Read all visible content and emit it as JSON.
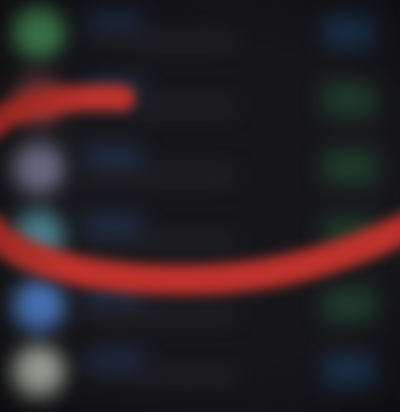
{
  "list": {
    "rows": [
      {
        "avatar_color": "#4c9a62",
        "action_color": "#1d3350",
        "avatar_icon": "app-icon"
      },
      {
        "avatar_color": "#7a3b3f",
        "action_color": "#1f3a2a",
        "avatar_icon": "app-icon"
      },
      {
        "avatar_color": "#6c6b82",
        "action_color": "#1f3a2a",
        "avatar_icon": "app-icon"
      },
      {
        "avatar_color": "#4b7f8c",
        "action_color": "#1f3a2a",
        "avatar_icon": "app-icon"
      },
      {
        "avatar_color": "#4f7fc9",
        "action_color": "#1f3a2a",
        "avatar_icon": "app-icon"
      },
      {
        "avatar_color": "#c6cdbf",
        "action_color": "#1d3350",
        "avatar_icon": "app-icon"
      }
    ]
  },
  "annotation": {
    "stroke_color": "#c0322c"
  }
}
